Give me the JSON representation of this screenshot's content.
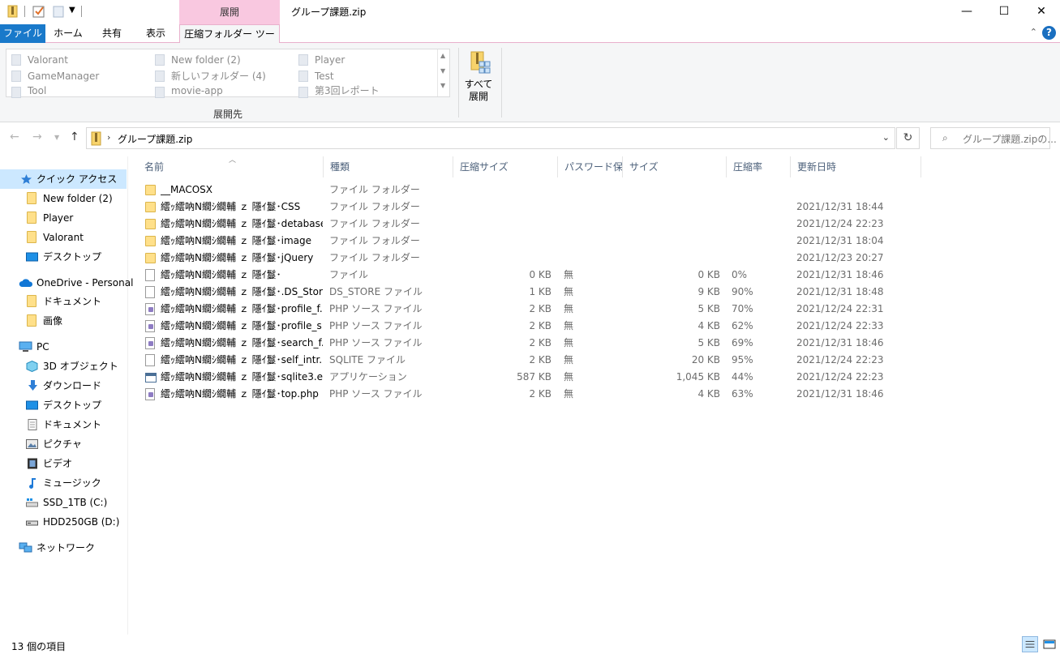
{
  "window": {
    "title": "グループ課題.zip",
    "context_tab": "展開",
    "minimize": "—",
    "maximize": "☐",
    "close": "✕"
  },
  "ribbon_tabs": {
    "file": "ファイル",
    "home": "ホーム",
    "share": "共有",
    "view": "表示",
    "compressed_tools": "圧縮フォルダー ツール",
    "collapse": "⌃",
    "help": "?"
  },
  "ribbon": {
    "destinations": [
      "Valorant",
      "GameManager",
      "Tool",
      "New folder (2)",
      "新しいフォルダー (4)",
      "movie-app",
      "Player",
      "Test",
      "第3回レポート"
    ],
    "destinations_group_label": "展開先",
    "extract_all_label": "すべて\n展開"
  },
  "address": {
    "path": "グループ課題.zip",
    "search_placeholder": "グループ課題.zipの..."
  },
  "nav_pane": {
    "items": [
      {
        "label": "クイック アクセス",
        "icon": "star-icon"
      },
      {
        "label": "New folder (2)",
        "icon": "folder-icon"
      },
      {
        "label": "Player",
        "icon": "folder-icon"
      },
      {
        "label": "Valorant",
        "icon": "folder-icon"
      },
      {
        "label": "デスクトップ",
        "icon": "desktop-icon"
      },
      {
        "label": "OneDrive - Personal",
        "icon": "cloud-icon"
      },
      {
        "label": "ドキュメント",
        "icon": "folder-icon"
      },
      {
        "label": "画像",
        "icon": "folder-icon"
      },
      {
        "label": "PC",
        "icon": "pc-icon"
      },
      {
        "label": "3D オブジェクト",
        "icon": "cube-icon"
      },
      {
        "label": "ダウンロード",
        "icon": "download-icon"
      },
      {
        "label": "デスクトップ",
        "icon": "desktop-icon"
      },
      {
        "label": "ドキュメント",
        "icon": "document-icon"
      },
      {
        "label": "ピクチャ",
        "icon": "pictures-icon"
      },
      {
        "label": "ビデオ",
        "icon": "video-icon"
      },
      {
        "label": "ミュージック",
        "icon": "music-icon"
      },
      {
        "label": "SSD_1TB (C:)",
        "icon": "drive-icon"
      },
      {
        "label": "HDD250GB (D:)",
        "icon": "drive-icon"
      },
      {
        "label": "ネットワーク",
        "icon": "network-icon"
      }
    ]
  },
  "columns": [
    "名前",
    "種類",
    "圧縮サイズ",
    "パスワード保...",
    "サイズ",
    "圧縮率",
    "更新日時"
  ],
  "files": [
    {
      "name": "__MACOSX",
      "type": "ファイル フォルダー",
      "csize": "",
      "pass": "",
      "size": "",
      "ratio": "",
      "date": "",
      "icon": "folder"
    },
    {
      "name": "繧ｯ繧吶Ν繝ｼ繝輔 ｚ 隱ｲ鬘･CSS",
      "type": "ファイル フォルダー",
      "csize": "",
      "pass": "",
      "size": "",
      "ratio": "",
      "date": "2021/12/31 18:44",
      "icon": "folder"
    },
    {
      "name": "繧ｯ繧吶Ν繝ｼ繝輔 ｚ 隱ｲ鬘･detabase",
      "type": "ファイル フォルダー",
      "csize": "",
      "pass": "",
      "size": "",
      "ratio": "",
      "date": "2021/12/24 22:23",
      "icon": "folder"
    },
    {
      "name": "繧ｯ繧吶Ν繝ｼ繝輔 ｚ 隱ｲ鬘･image",
      "type": "ファイル フォルダー",
      "csize": "",
      "pass": "",
      "size": "",
      "ratio": "",
      "date": "2021/12/31 18:04",
      "icon": "folder"
    },
    {
      "name": "繧ｯ繧吶Ν繝ｼ繝輔 ｚ 隱ｲ鬘･jQuery",
      "type": "ファイル フォルダー",
      "csize": "",
      "pass": "",
      "size": "",
      "ratio": "",
      "date": "2021/12/23 20:27",
      "icon": "folder"
    },
    {
      "name": "繧ｯ繧吶Ν繝ｼ繝輔 ｚ 隱ｲ鬘･",
      "type": "ファイル",
      "csize": "0 KB",
      "pass": "無",
      "size": "0 KB",
      "ratio": "0%",
      "date": "2021/12/31 18:46",
      "icon": "file"
    },
    {
      "name": "繧ｯ繧吶Ν繝ｼ繝輔 ｚ 隱ｲ鬘･.DS_Store",
      "type": "DS_STORE ファイル",
      "csize": "1 KB",
      "pass": "無",
      "size": "9 KB",
      "ratio": "90%",
      "date": "2021/12/31 18:48",
      "icon": "file"
    },
    {
      "name": "繧ｯ繧吶Ν繝ｼ繝輔 ｚ 隱ｲ鬘･profile_f...",
      "type": "PHP ソース ファイル",
      "csize": "2 KB",
      "pass": "無",
      "size": "5 KB",
      "ratio": "70%",
      "date": "2021/12/24 22:31",
      "icon": "php"
    },
    {
      "name": "繧ｯ繧吶Ν繝ｼ繝輔 ｚ 隱ｲ鬘･profile_s...",
      "type": "PHP ソース ファイル",
      "csize": "2 KB",
      "pass": "無",
      "size": "4 KB",
      "ratio": "62%",
      "date": "2021/12/24 22:33",
      "icon": "php"
    },
    {
      "name": "繧ｯ繧吶Ν繝ｼ繝輔 ｚ 隱ｲ鬘･search_f...",
      "type": "PHP ソース ファイル",
      "csize": "2 KB",
      "pass": "無",
      "size": "5 KB",
      "ratio": "69%",
      "date": "2021/12/31 18:46",
      "icon": "php"
    },
    {
      "name": "繧ｯ繧吶Ν繝ｼ繝輔 ｚ 隱ｲ鬘･self_intr...",
      "type": "SQLITE ファイル",
      "csize": "2 KB",
      "pass": "無",
      "size": "20 KB",
      "ratio": "95%",
      "date": "2021/12/24 22:23",
      "icon": "file"
    },
    {
      "name": "繧ｯ繧吶Ν繝ｼ繝輔 ｚ 隱ｲ鬘･sqlite3.e...",
      "type": "アプリケーション",
      "csize": "587 KB",
      "pass": "無",
      "size": "1,045 KB",
      "ratio": "44%",
      "date": "2021/12/24 22:23",
      "icon": "app"
    },
    {
      "name": "繧ｯ繧吶Ν繝ｼ繝輔 ｚ 隱ｲ鬘･top.php",
      "type": "PHP ソース ファイル",
      "csize": "2 KB",
      "pass": "無",
      "size": "4 KB",
      "ratio": "63%",
      "date": "2021/12/31 18:46",
      "icon": "php"
    }
  ],
  "status": {
    "item_count": "13 個の項目"
  }
}
